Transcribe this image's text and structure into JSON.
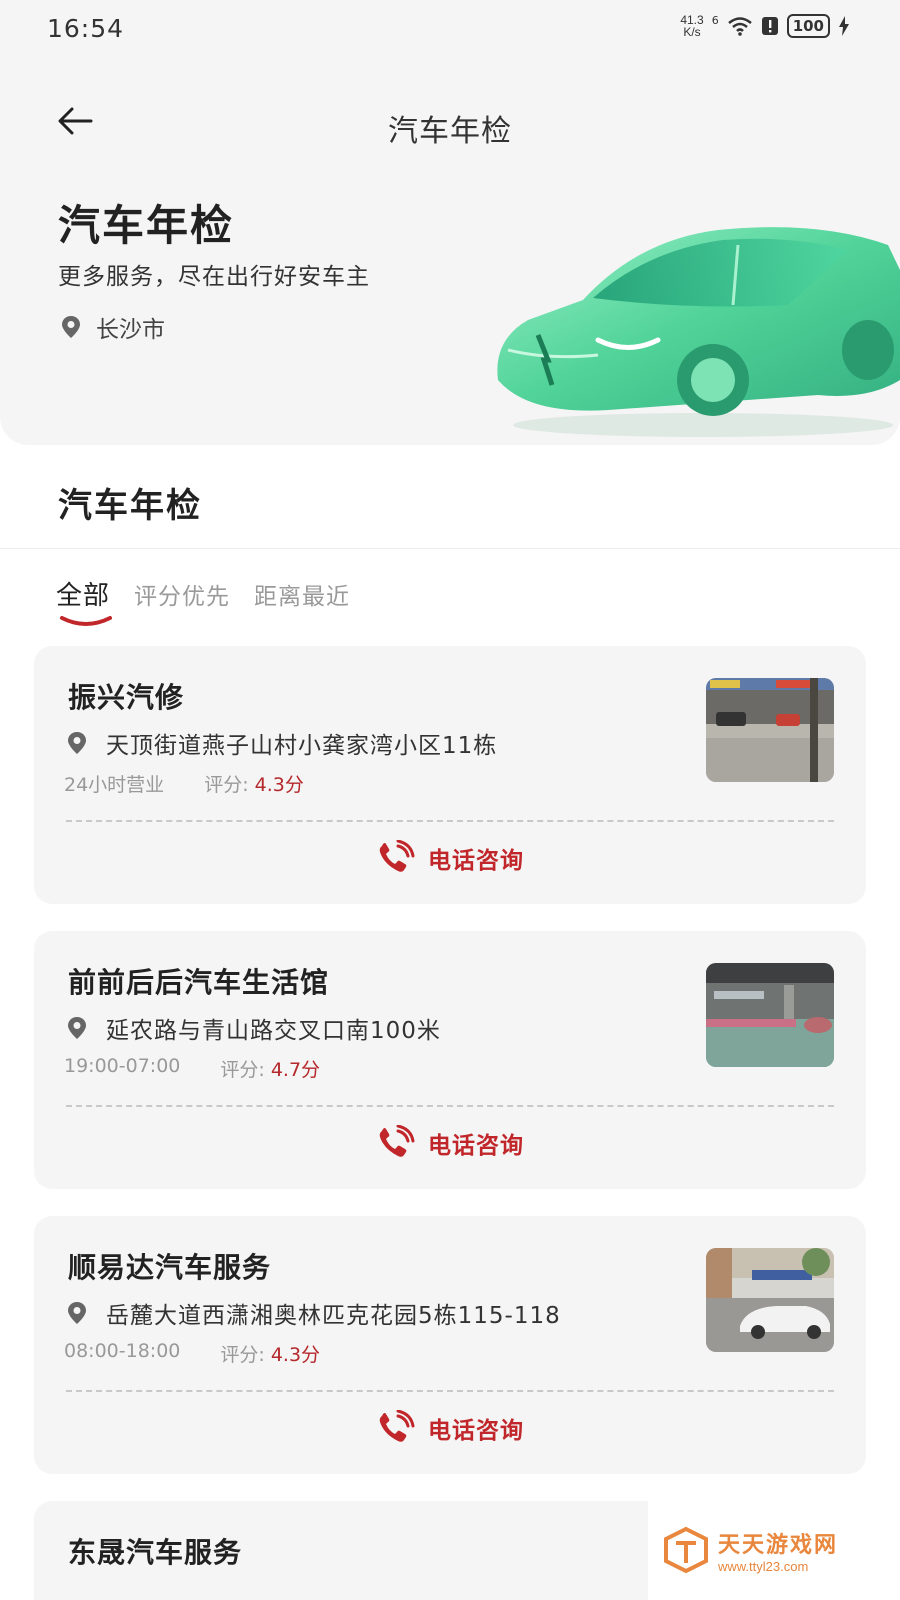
{
  "status_bar": {
    "time": "16:54",
    "net_speed_value": "41.3",
    "net_speed_unit": "K/s",
    "signal_label": "6",
    "battery": "100"
  },
  "nav": {
    "title": "汽车年检",
    "back_icon": "back-arrow-icon"
  },
  "hero": {
    "title": "汽车年检",
    "subtitle": "更多服务，尽在出行好安车主",
    "location": "长沙市"
  },
  "section": {
    "title": "汽车年检"
  },
  "tabs": [
    {
      "label": "全部",
      "active": true
    },
    {
      "label": "评分优先",
      "active": false
    },
    {
      "label": "距离最近",
      "active": false
    }
  ],
  "shops": [
    {
      "name": "振兴汽修",
      "address": "天顶街道燕子山村小龚家湾小区11栋",
      "hours": "24小时营业",
      "rating_label": "评分:",
      "rating": "4.3分",
      "call_label": "电话咨询"
    },
    {
      "name": "前前后后汽车生活馆",
      "address": "延农路与青山路交叉口南100米",
      "hours": "19:00-07:00",
      "rating_label": "评分:",
      "rating": "4.7分",
      "call_label": "电话咨询"
    },
    {
      "name": "顺易达汽车服务",
      "address": "岳麓大道西潇湘奥林匹克花园5栋115-118",
      "hours": "08:00-18:00",
      "rating_label": "评分:",
      "rating": "4.3分",
      "call_label": "电话咨询"
    },
    {
      "name": "东晟汽车服务"
    }
  ],
  "watermark": {
    "main": "天天游戏网",
    "sub": "www.ttyl23.com"
  },
  "colors": {
    "accent": "#c0262a",
    "rating": "#b5282b",
    "card_bg": "#f5f5f5",
    "car_green": "#3ecf8e"
  }
}
